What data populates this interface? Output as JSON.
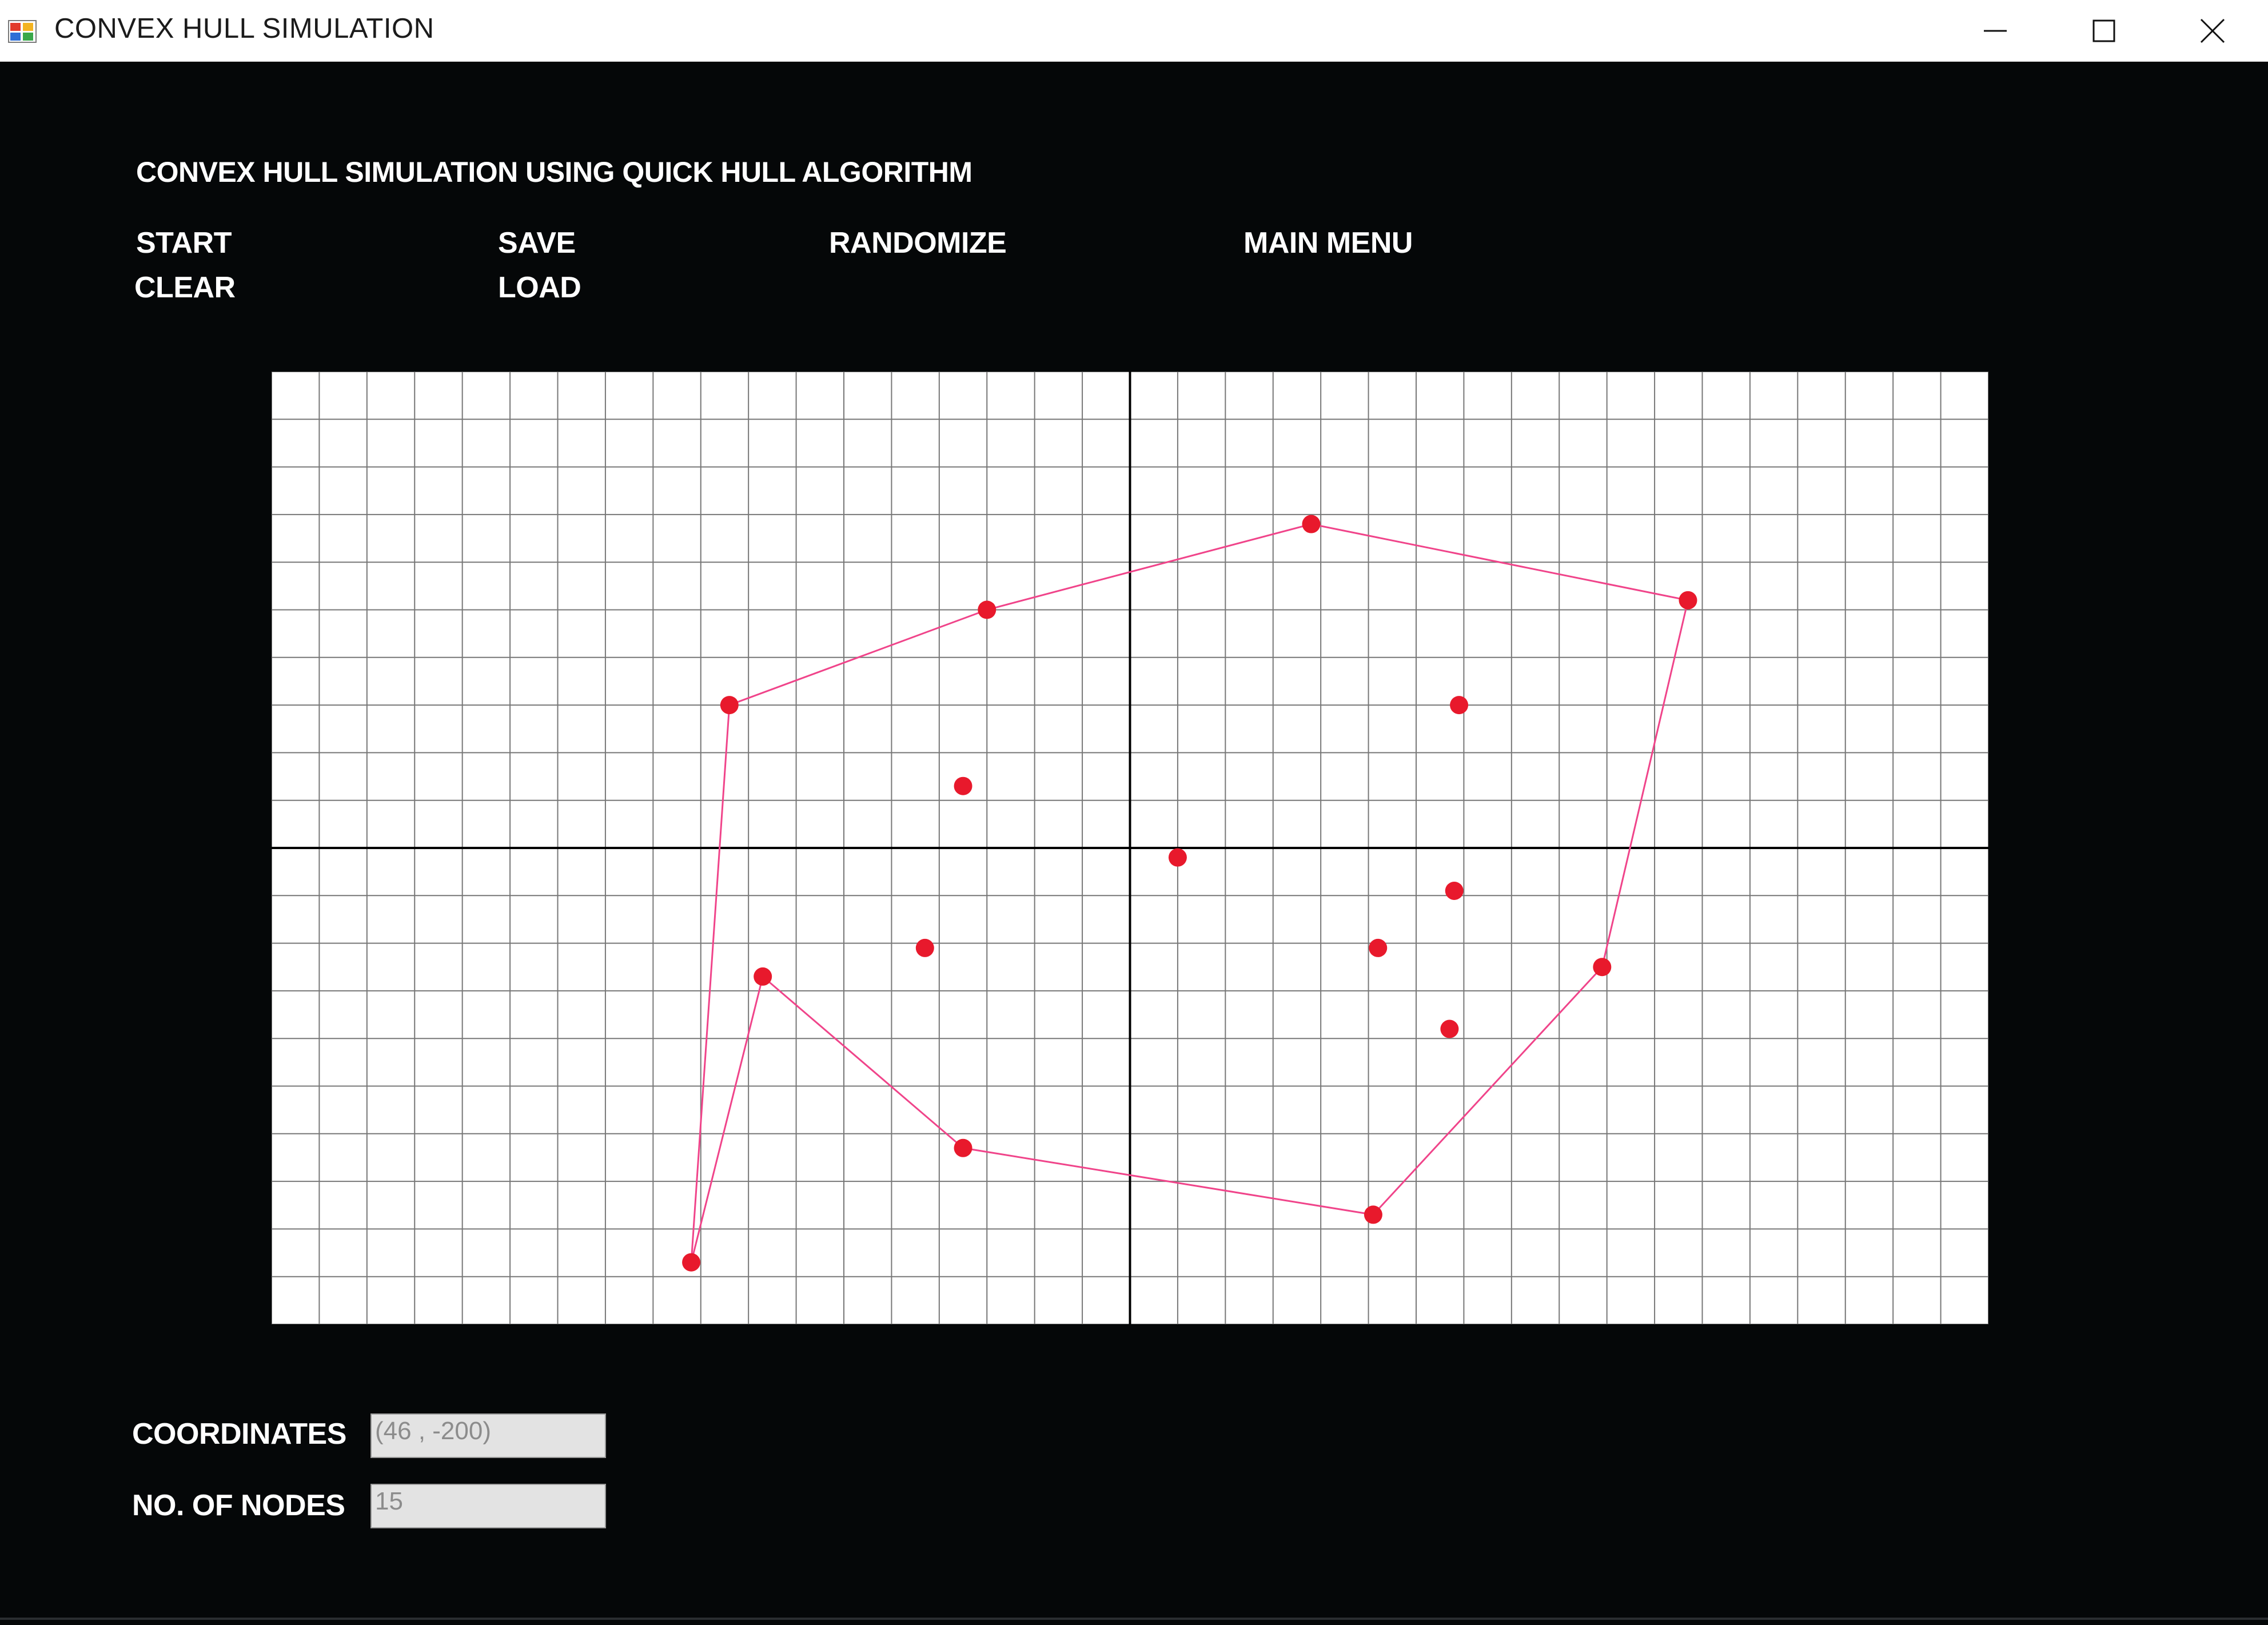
{
  "window": {
    "title": "CONVEX HULL SIMULATION",
    "icon": "app-window-icon",
    "controls": [
      "minimize-icon",
      "maximize-icon",
      "close-icon"
    ]
  },
  "heading": "CONVEX HULL SIMULATION USING QUICK HULL ALGORITHM",
  "menu": {
    "start": "START",
    "clear": "CLEAR",
    "save": "SAVE",
    "load": "LOAD",
    "randomize": "RANDOMIZE",
    "main_menu": "MAIN MENU"
  },
  "plot": {
    "grid_columns": 36,
    "grid_rows": 20,
    "node_color": "#e8192c",
    "hull_color": "#f0448a",
    "points": [
      {
        "col": 10.3,
        "row": 12.7
      },
      {
        "col": 8.8,
        "row": 18.7
      },
      {
        "col": 9.6,
        "row": 7.0
      },
      {
        "col": 15.0,
        "row": 5.0
      },
      {
        "col": 21.8,
        "row": 3.2
      },
      {
        "col": 29.7,
        "row": 4.8
      },
      {
        "col": 27.9,
        "row": 12.5
      },
      {
        "col": 23.1,
        "row": 17.7
      },
      {
        "col": 14.5,
        "row": 16.3
      },
      {
        "col": 14.5,
        "row": 8.7
      },
      {
        "col": 13.7,
        "row": 12.1
      },
      {
        "col": 19.0,
        "row": 10.2
      },
      {
        "col": 23.2,
        "row": 12.1
      },
      {
        "col": 24.9,
        "row": 7.0
      },
      {
        "col": 24.8,
        "row": 10.9
      },
      {
        "col": 24.7,
        "row": 13.8
      }
    ],
    "hull_order": [
      1,
      2,
      3,
      4,
      5,
      6,
      7,
      8,
      0
    ]
  },
  "coordinates": {
    "label": "COORDINATES",
    "value": "(46 , -200)"
  },
  "nodes": {
    "label": "NO. OF NODES",
    "value": "15"
  }
}
